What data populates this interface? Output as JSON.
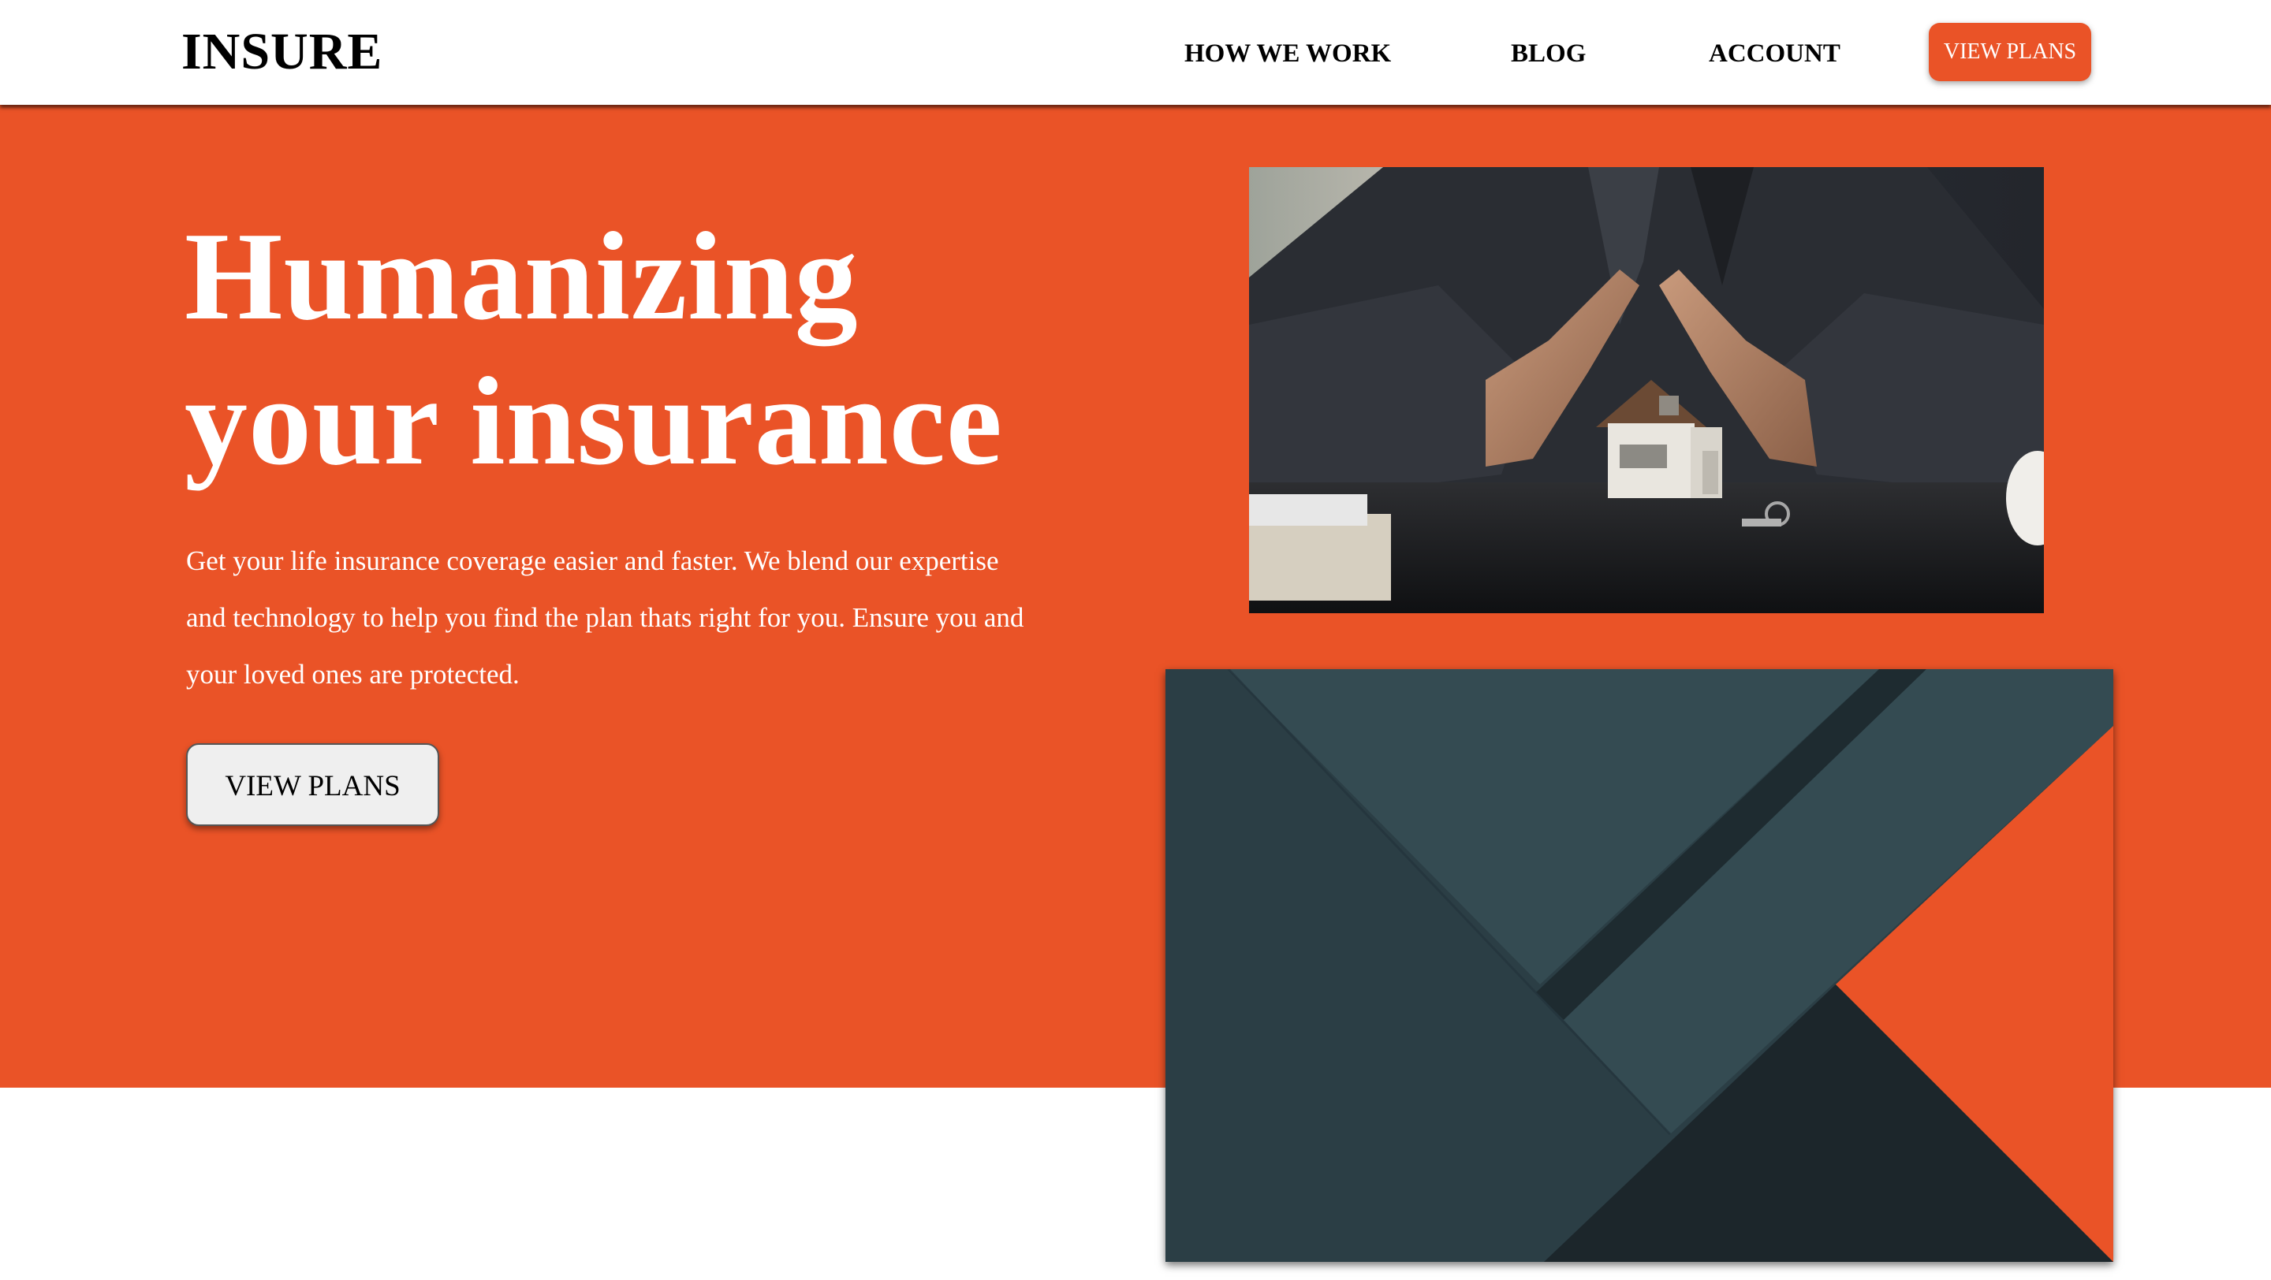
{
  "navbar": {
    "logo": "INSURE",
    "links": [
      {
        "label": "HOW WE WORK"
      },
      {
        "label": "BLOG"
      },
      {
        "label": "ACCOUNT"
      }
    ],
    "cta_label": "VIEW PLANS"
  },
  "hero": {
    "title": "Humanizing your insurance",
    "description": "Get your life insurance coverage easier and faster. We blend our expertise and technology to help you find the plan thats right for you. Ensure you and your loved ones are protected.",
    "button_label": "VIEW PLANS"
  },
  "images": {
    "photo_icon": "hands-over-house-photo",
    "graphic_icon": "abstract-geometric-graphic"
  },
  "colors": {
    "accent": "#ea5327",
    "dark_slate": "#2b3e45",
    "mid_slate": "#344b52",
    "deep_slate": "#1c262b",
    "white": "#ffffff"
  }
}
